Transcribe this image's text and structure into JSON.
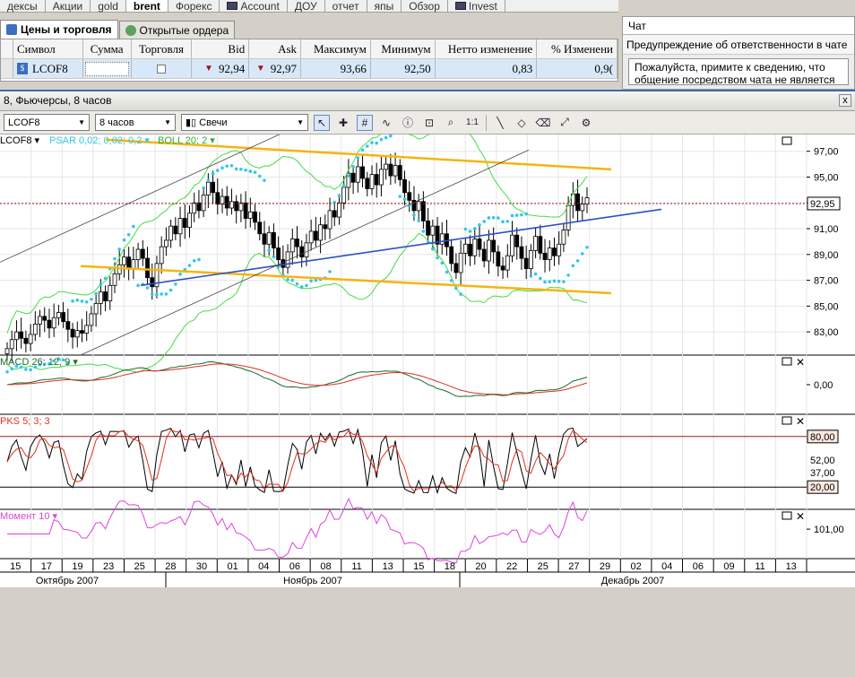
{
  "top_nav": [
    {
      "label": "дексы",
      "active": false
    },
    {
      "label": "Акции",
      "active": false
    },
    {
      "label": "gold",
      "active": false
    },
    {
      "label": "brent",
      "active": true
    },
    {
      "label": "Форекс",
      "active": false
    },
    {
      "label": "Account",
      "active": false,
      "icon": "account-icon"
    },
    {
      "label": "ДОУ",
      "active": false
    },
    {
      "label": "отчет",
      "active": false
    },
    {
      "label": "япы",
      "active": false
    },
    {
      "label": "Обзор",
      "active": false
    },
    {
      "label": "Invest",
      "active": false,
      "icon": "invest-icon"
    }
  ],
  "panel_tabs": [
    {
      "label": "Цены и торговля",
      "active": true,
      "icon": "prices-icon"
    },
    {
      "label": "Открытые ордера",
      "active": false,
      "icon": "orders-icon"
    }
  ],
  "quotes": {
    "headers": [
      "Символ",
      "Сумма",
      "Торговля",
      "Bid",
      "Ask",
      "Максимум",
      "Минимум",
      "Нетто изменение",
      "% Изменени"
    ],
    "row": {
      "symbol": "LCOF8",
      "amount": "",
      "bid": "92,94",
      "ask": "92,97",
      "max": "93,66",
      "min": "92,50",
      "net": "0,83",
      "pct": "0,9("
    }
  },
  "chat": {
    "title": "Чат",
    "warning": "Предупреждение об ответственности в чате",
    "message": "Пожалуйста, примите к сведению, что общение посредством чата не является и не должно"
  },
  "chart_window": {
    "title": "8, Фьючерсы, 8 часов",
    "close_label": "x",
    "symbol": "LCOF8",
    "period": "8 часов",
    "chart_type": "Свечи",
    "one_to_one": "1:1"
  },
  "colors": {
    "up": "#ffffff",
    "down": "#000000",
    "psar": "#33c6e8",
    "boll": "#44dd44",
    "channel": "#f5b40f",
    "trend": "#2e4fc8",
    "macd": "#1c6a2a",
    "signal": "#e03020",
    "moment": "#dd44dd",
    "current": "#a01818"
  },
  "chart_data": {
    "type": "candlestick",
    "main_label": "LCOF8",
    "psar_label": "PSAR 0,02; 0,02; 0,2",
    "boll_label": "BOLL 20; 2",
    "macd_label": "MACD 26; 12; 9",
    "pks_label": "PKS 5; 3; 3",
    "moment_label": "Момент 10",
    "y_ticks": [
      "97,00",
      "95,00",
      "93,00",
      "91,00",
      "89,00",
      "87,00",
      "85,00",
      "83,00"
    ],
    "y_range": [
      81.2,
      98.3
    ],
    "current_price": "92,95",
    "macd_tick": "0,00",
    "pks_ticks": [
      "80,00",
      "52,00",
      "37,00",
      "20,00"
    ],
    "moment_tick": "101,00",
    "x_dates": [
      "15",
      "17",
      "19",
      "23",
      "25",
      "28",
      "30",
      "01",
      "04",
      "06",
      "08",
      "11",
      "13",
      "15",
      "18",
      "20",
      "22",
      "25",
      "27",
      "29",
      "02",
      "04",
      "06",
      "09",
      "11",
      "13"
    ],
    "x_months": [
      "Октябрь 2007",
      "Ноябрь 2007",
      "Декабрь 2007"
    ],
    "closes": [
      81.7,
      82.4,
      83,
      82.5,
      82.1,
      82.8,
      83.6,
      84.2,
      83.9,
      83.3,
      84.1,
      84.5,
      83.8,
      83.2,
      82.6,
      83.1,
      82.9,
      83.5,
      84.4,
      85.2,
      86.1,
      85.4,
      86.6,
      87.5,
      88.2,
      88.8,
      87.9,
      88.6,
      89.4,
      88.7,
      87.2,
      86.5,
      88.3,
      89.6,
      90.1,
      91.2,
      90.6,
      91.8,
      91.1,
      92.2,
      93,
      92.4,
      93.6,
      94.6,
      93.8,
      92.9,
      93.5,
      92.6,
      93.1,
      92.4,
      93,
      91.8,
      92.3,
      91.5,
      90.6,
      89.8,
      90.7,
      89.5,
      88.6,
      88,
      89.2,
      90.2,
      89.6,
      88.8,
      89.9,
      90.8,
      90.1,
      91.3,
      91,
      92.4,
      91.9,
      93,
      94.2,
      95.3,
      94.6,
      95.8,
      94.9,
      94.1,
      95.2,
      94.4,
      95.6,
      96,
      95.1,
      95.9,
      94.8,
      93.8,
      93.2,
      92.4,
      93.1,
      91.6,
      90.5,
      91.2,
      89.8,
      90.6,
      89.6,
      88.3,
      87.6,
      89.1,
      89.8,
      88.9,
      90.2,
      89.4,
      88.5,
      90.1,
      89.2,
      88.1,
      87.8,
      88.9,
      90.5,
      89.6,
      88.7,
      87.9,
      89.3,
      90.4,
      89.1,
      88.6,
      89.5,
      88.9,
      89.8,
      90.9,
      92.8,
      93.7,
      92.4,
      92.9,
      93.4
    ]
  }
}
